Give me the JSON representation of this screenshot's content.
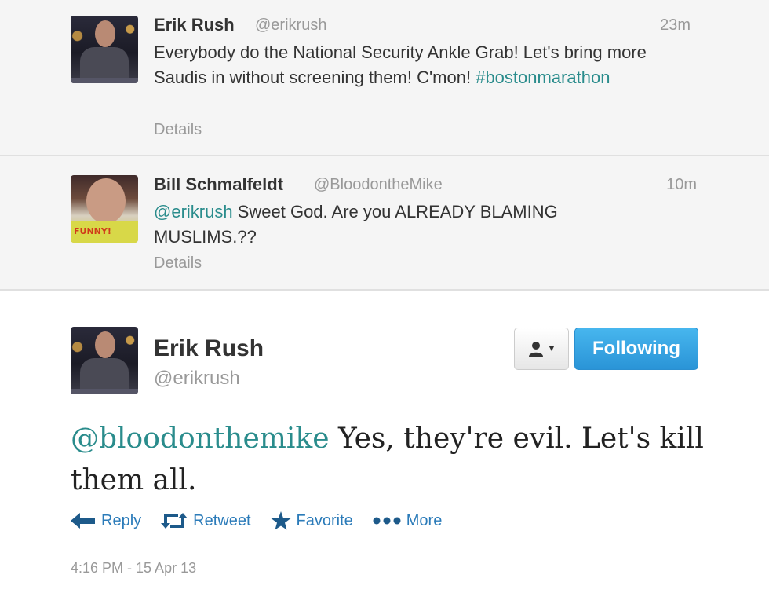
{
  "colors": {
    "link": "#2b7bb9",
    "hashtag_link": "#2a8c8c",
    "follow_button": "#2a94d7",
    "corner": "#5fbf4a"
  },
  "tweets": [
    {
      "name": "Erik Rush",
      "handle": "@erikrush",
      "time": "23m",
      "text": "Everybody do the National Security Ankle Grab! Let's bring more Saudis in without screening them! C'mon!",
      "hashtag": "#bostonmarathon",
      "details": "Details"
    },
    {
      "name": "Bill Schmalfeldt",
      "handle": "@BloodontheMike",
      "time": "10m",
      "mention": "@erikrush",
      "text": " Sweet God. Are you ALREADY BLAMING MUSLIMS.??",
      "details": "Details",
      "avatar_caption": "FUNNY!"
    }
  ],
  "main_tweet": {
    "name": "Erik Rush",
    "handle": "@erikrush",
    "mention": "@bloodonthemike",
    "text": " Yes, they're evil. Let's kill them all.",
    "timestamp": "4:16 PM - 15 Apr 13",
    "follow_label": "Following",
    "actions": {
      "reply": "Reply",
      "retweet": "Retweet",
      "favorite": "Favorite",
      "more": "More"
    }
  },
  "icons": {
    "corner": "corner-arrow-icon",
    "user_menu": "user-icon",
    "reply": "reply-icon",
    "retweet": "retweet-icon",
    "favorite": "star-icon",
    "more": "more-dots-icon"
  }
}
